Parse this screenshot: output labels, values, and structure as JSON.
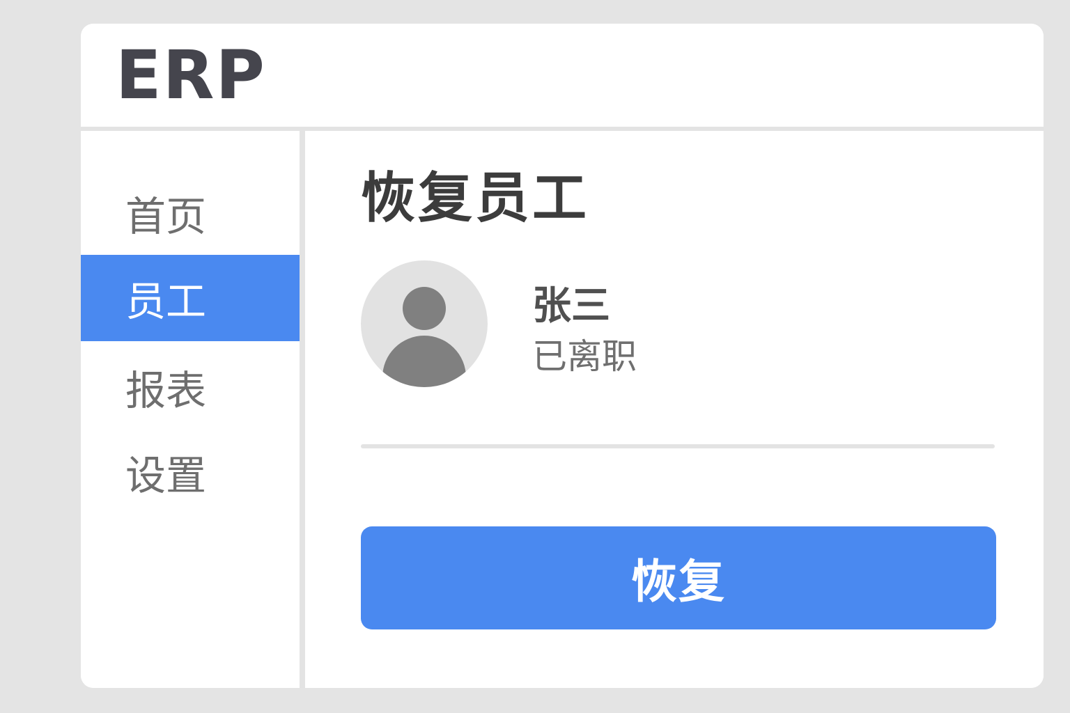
{
  "app": {
    "title": "ERP"
  },
  "sidebar": {
    "items": [
      {
        "label": "首页",
        "active": false
      },
      {
        "label": "员工",
        "active": true
      },
      {
        "label": "报表",
        "active": false
      },
      {
        "label": "设置",
        "active": false
      }
    ]
  },
  "main": {
    "title": "恢复员工",
    "employee": {
      "avatar_icon": "user-avatar-icon",
      "name": "张三",
      "status": "已离职"
    },
    "restore_button_label": "恢复"
  },
  "colors": {
    "accent": "#4a89f0",
    "background": "#e4e4e4",
    "divider": "#e3e3e3",
    "avatar_bg": "#e2e2e2",
    "avatar_fg": "#808080"
  }
}
